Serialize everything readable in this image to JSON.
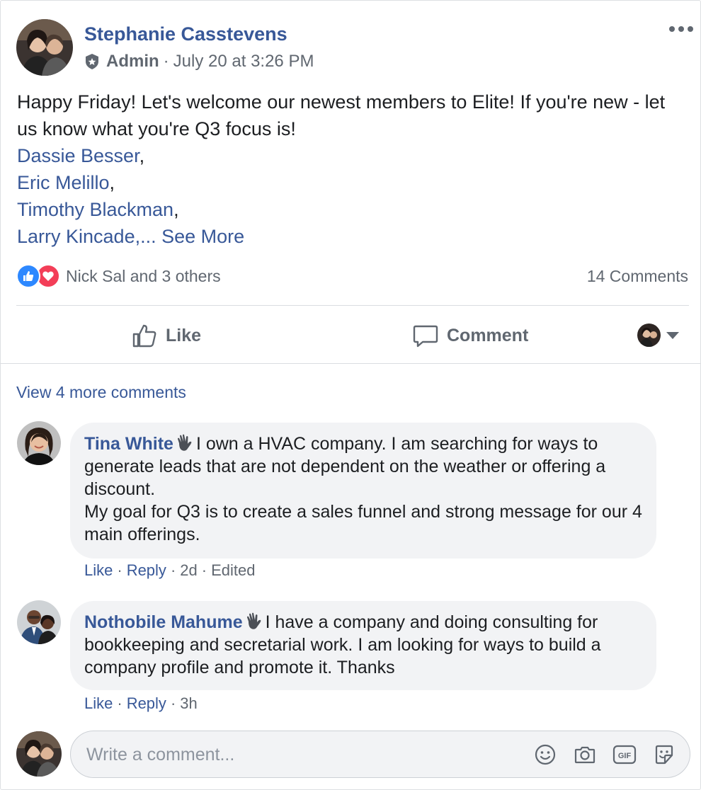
{
  "post": {
    "author": "Stephanie Casstevens",
    "role": "Admin",
    "separator": "·",
    "timestamp": "July 20 at 3:26 PM",
    "text_line1": "Happy Friday! Let's welcome our newest members to Elite! If you're new - let us know what you're Q3 focus is!",
    "mentions": [
      {
        "name": "Dassie Besser",
        "suffix": ","
      },
      {
        "name": "Eric Melillo",
        "suffix": ","
      },
      {
        "name": "Timothy Blackman",
        "suffix": ","
      },
      {
        "name": "Larry Kincade",
        "suffix": ",..."
      }
    ],
    "see_more": "See More",
    "reactions_text": "Nick Sal and 3 others",
    "comments_count": "14 Comments",
    "more_options_icon": "more-options-icon"
  },
  "actions": {
    "like": "Like",
    "comment": "Comment"
  },
  "comments_section": {
    "view_more": "View 4 more comments",
    "comments": [
      {
        "author": "Tina White",
        "text_1": "I own a HVAC company. I am searching for ways to generate leads that are not dependent on the weather or offering a discount.",
        "text_2": "My goal for Q3 is to create a sales funnel and strong message for our 4 main offerings.",
        "like": "Like",
        "reply": "Reply",
        "time": "2d",
        "edited": "Edited"
      },
      {
        "author": "Nothobile Mahume",
        "text_1": "I have a company and doing consulting for bookkeeping and secretarial work. I am looking for ways to build a company profile and promote it. Thanks",
        "like": "Like",
        "reply": "Reply",
        "time": "3h"
      }
    ],
    "dot": "·",
    "write_placeholder": "Write a comment...",
    "tool_icons": [
      "emoji-icon",
      "camera-icon",
      "gif-icon",
      "sticker-icon"
    ],
    "gif_label": "GIF"
  },
  "colors": {
    "link": "#385898",
    "meta": "#606770",
    "like_blue": "#2d88ff",
    "love_red": "#f33e58",
    "bubble_bg": "#f2f3f5"
  }
}
